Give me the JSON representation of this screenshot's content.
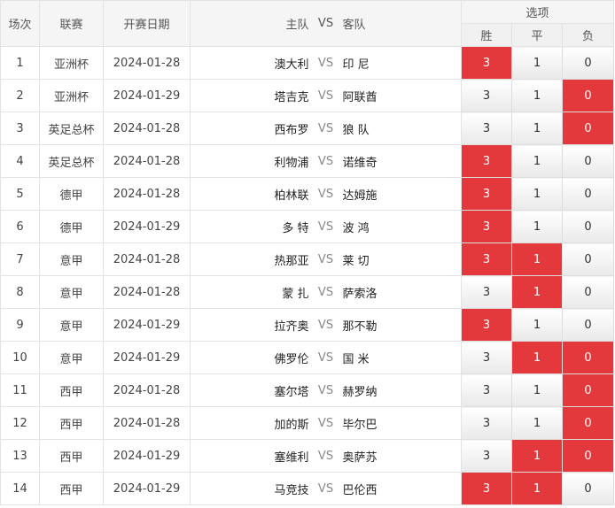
{
  "header": {
    "col_num": "场次",
    "col_league": "联赛",
    "col_date": "开赛日期",
    "col_home": "主队",
    "col_vs": "VS",
    "col_away": "客队",
    "col_options": "选项",
    "opt_win": "胜",
    "opt_draw": "平",
    "opt_lose": "负"
  },
  "rows": [
    {
      "num": "1",
      "league": "亚洲杯",
      "date": "2024-01-28",
      "home": "澳大利",
      "vs": "VS",
      "away": "印 尼",
      "win": "3",
      "draw": "1",
      "lose": "0",
      "selected": [
        "win"
      ]
    },
    {
      "num": "2",
      "league": "亚洲杯",
      "date": "2024-01-29",
      "home": "塔吉克",
      "vs": "VS",
      "away": "阿联酋",
      "win": "3",
      "draw": "1",
      "lose": "0",
      "selected": [
        "lose"
      ]
    },
    {
      "num": "3",
      "league": "英足总杯",
      "date": "2024-01-28",
      "home": "西布罗",
      "vs": "VS",
      "away": "狼 队",
      "win": "3",
      "draw": "1",
      "lose": "0",
      "selected": [
        "lose"
      ]
    },
    {
      "num": "4",
      "league": "英足总杯",
      "date": "2024-01-28",
      "home": "利物浦",
      "vs": "VS",
      "away": "诺维奇",
      "win": "3",
      "draw": "1",
      "lose": "0",
      "selected": [
        "win"
      ]
    },
    {
      "num": "5",
      "league": "德甲",
      "date": "2024-01-28",
      "home": "柏林联",
      "vs": "VS",
      "away": "达姆施",
      "win": "3",
      "draw": "1",
      "lose": "0",
      "selected": [
        "win"
      ]
    },
    {
      "num": "6",
      "league": "德甲",
      "date": "2024-01-29",
      "home": "多 特",
      "vs": "VS",
      "away": "波 鸿",
      "win": "3",
      "draw": "1",
      "lose": "0",
      "selected": [
        "win"
      ]
    },
    {
      "num": "7",
      "league": "意甲",
      "date": "2024-01-28",
      "home": "热那亚",
      "vs": "VS",
      "away": "莱 切",
      "win": "3",
      "draw": "1",
      "lose": "0",
      "selected": [
        "win",
        "draw"
      ]
    },
    {
      "num": "8",
      "league": "意甲",
      "date": "2024-01-28",
      "home": "蒙 扎",
      "vs": "VS",
      "away": "萨索洛",
      "win": "3",
      "draw": "1",
      "lose": "0",
      "selected": [
        "draw"
      ]
    },
    {
      "num": "9",
      "league": "意甲",
      "date": "2024-01-29",
      "home": "拉齐奥",
      "vs": "VS",
      "away": "那不勒",
      "win": "3",
      "draw": "1",
      "lose": "0",
      "selected": [
        "win"
      ]
    },
    {
      "num": "10",
      "league": "意甲",
      "date": "2024-01-29",
      "home": "佛罗伦",
      "vs": "VS",
      "away": "国 米",
      "win": "3",
      "draw": "1",
      "lose": "0",
      "selected": [
        "draw",
        "lose"
      ]
    },
    {
      "num": "11",
      "league": "西甲",
      "date": "2024-01-28",
      "home": "塞尔塔",
      "vs": "VS",
      "away": "赫罗纳",
      "win": "3",
      "draw": "1",
      "lose": "0",
      "selected": [
        "lose"
      ]
    },
    {
      "num": "12",
      "league": "西甲",
      "date": "2024-01-28",
      "home": "加的斯",
      "vs": "VS",
      "away": "毕尔巴",
      "win": "3",
      "draw": "1",
      "lose": "0",
      "selected": [
        "lose"
      ]
    },
    {
      "num": "13",
      "league": "西甲",
      "date": "2024-01-29",
      "home": "塞维利",
      "vs": "VS",
      "away": "奥萨苏",
      "win": "3",
      "draw": "1",
      "lose": "0",
      "selected": [
        "draw",
        "lose"
      ]
    },
    {
      "num": "14",
      "league": "西甲",
      "date": "2024-01-29",
      "home": "马竞技",
      "vs": "VS",
      "away": "巴伦西",
      "win": "3",
      "draw": "1",
      "lose": "0",
      "selected": [
        "win",
        "draw"
      ]
    }
  ],
  "colors": {
    "selected_bg": "#e3393c",
    "selected_text": "#ffffff"
  }
}
